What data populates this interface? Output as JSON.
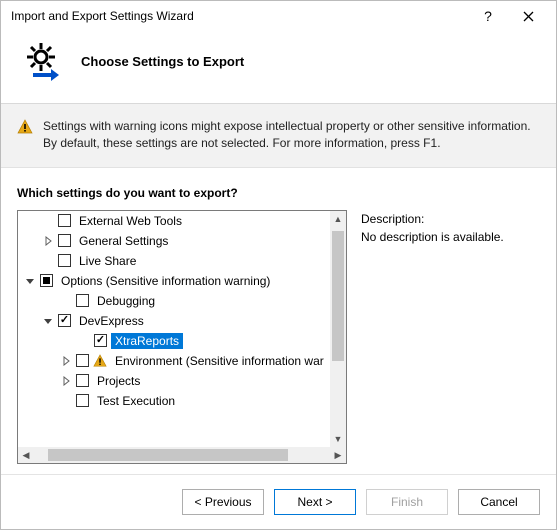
{
  "window": {
    "title": "Import and Export Settings Wizard"
  },
  "header": {
    "title": "Choose Settings to Export"
  },
  "info": {
    "text": "Settings with warning icons might expose intellectual property or other sensitive information. By default, these settings are not selected. For more information, press F1."
  },
  "prompt": "Which settings do you want to export?",
  "tree": [
    {
      "label": "External Web Tools",
      "indent": 1,
      "check": "unchecked",
      "expander": "none"
    },
    {
      "label": "General Settings",
      "indent": 1,
      "check": "unchecked",
      "expander": "collapsed"
    },
    {
      "label": "Live Share",
      "indent": 1,
      "check": "unchecked",
      "expander": "none"
    },
    {
      "label": "Options (Sensitive information warning)",
      "indent": 0,
      "check": "mixed",
      "expander": "expanded"
    },
    {
      "label": "Debugging",
      "indent": 2,
      "check": "unchecked",
      "expander": "none"
    },
    {
      "label": "DevExpress",
      "indent": 1,
      "check": "checked",
      "expander": "expanded"
    },
    {
      "label": "XtraReports",
      "indent": 3,
      "check": "checked",
      "expander": "none",
      "selected": true
    },
    {
      "label": "Environment (Sensitive information warning)",
      "indent": 2,
      "check": "unchecked",
      "expander": "collapsed",
      "warn": true,
      "truncated": "Environment (Sensitive information war"
    },
    {
      "label": "Projects",
      "indent": 2,
      "check": "unchecked",
      "expander": "collapsed"
    },
    {
      "label": "Test Execution",
      "indent": 2,
      "check": "unchecked",
      "expander": "none"
    }
  ],
  "description": {
    "title": "Description:",
    "text": "No description is available."
  },
  "buttons": {
    "previous": "< Previous",
    "next": "Next >",
    "finish": "Finish",
    "cancel": "Cancel"
  }
}
